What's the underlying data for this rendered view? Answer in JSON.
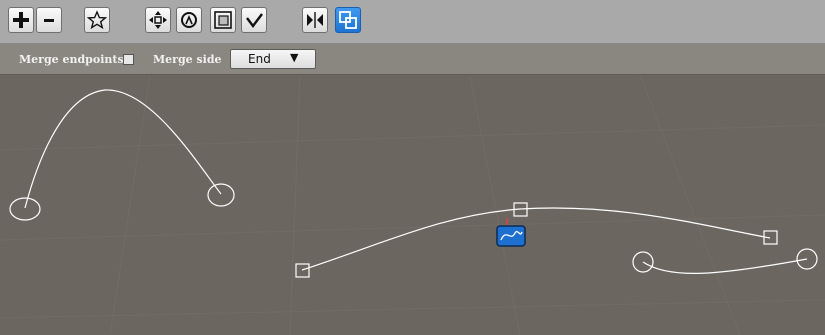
{
  "toolbar": {
    "buttons": [
      {
        "name": "add-button",
        "icon": "plus-icon"
      },
      {
        "name": "remove-button",
        "icon": "minus-icon"
      },
      {
        "name": "favorite-button",
        "icon": "star-icon"
      },
      {
        "name": "move-tool-button",
        "icon": "move-arrows-icon"
      },
      {
        "name": "rotate-tool-button",
        "icon": "rotate-icon"
      },
      {
        "name": "scale-tool-button",
        "icon": "scale-icon"
      },
      {
        "name": "split-tool-button",
        "icon": "split-icon"
      },
      {
        "name": "mirror-tool-button",
        "icon": "mirror-icon"
      },
      {
        "name": "merge-tool-button",
        "icon": "merge-icon",
        "active": true
      }
    ]
  },
  "options": {
    "merge_endpoints_label": "Merge endpoints",
    "merge_endpoints_checked": false,
    "merge_side_label": "Merge side",
    "merge_side_value": "End",
    "dropdown_arrow": "▼"
  },
  "colors": {
    "background": "#6b6660",
    "curve": "#ffffff",
    "active_button": "#2b86e4",
    "toolbar": "#a9a9a9",
    "option_bar": "#8a8680"
  }
}
